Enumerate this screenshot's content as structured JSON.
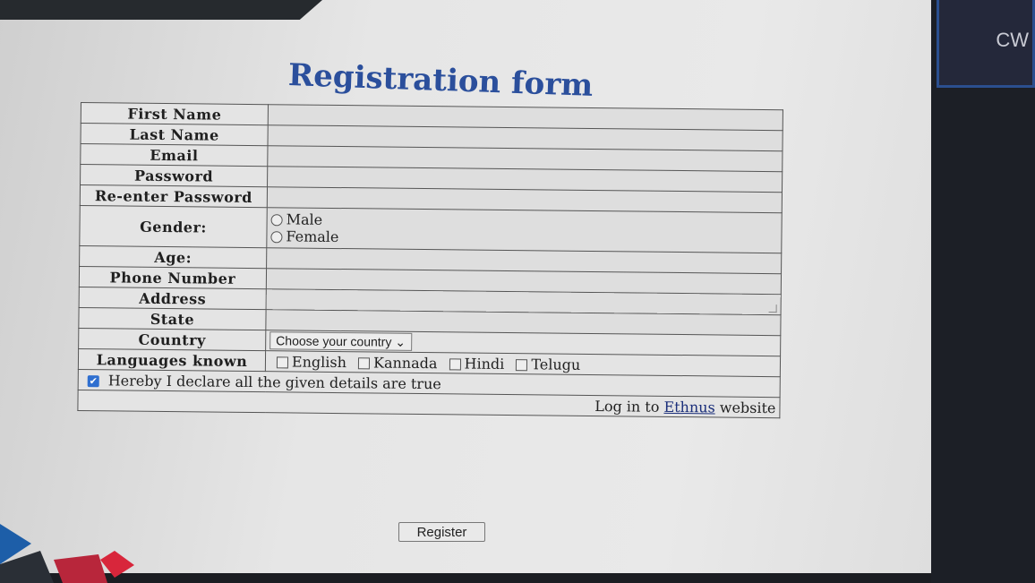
{
  "overlay": {
    "initials": "CW"
  },
  "form": {
    "title": "Registration form",
    "labels": {
      "first_name": "First Name",
      "last_name": "Last Name",
      "email": "Email",
      "password": "Password",
      "reenter_password": "Re-enter Password",
      "gender": "Gender:",
      "age": "Age:",
      "phone": "Phone Number",
      "address": "Address",
      "state": "State",
      "country": "Country",
      "languages": "Languages known"
    },
    "gender_options": [
      "Male",
      "Female"
    ],
    "country_select": {
      "selected": "Choose your country"
    },
    "languages": [
      "English",
      "Kannada",
      "Hindi",
      "Telugu"
    ],
    "declaration": {
      "checked": true,
      "text": "Hereby I declare all the given details are true"
    },
    "login_link": {
      "prefix": "Log in to",
      "link_text": "Ethnus",
      "suffix": "website"
    },
    "register_label": "Register"
  },
  "colors": {
    "title": "#2b4f9c",
    "link": "#1a2e7a",
    "checkbox_checked": "#2f6fd0"
  }
}
